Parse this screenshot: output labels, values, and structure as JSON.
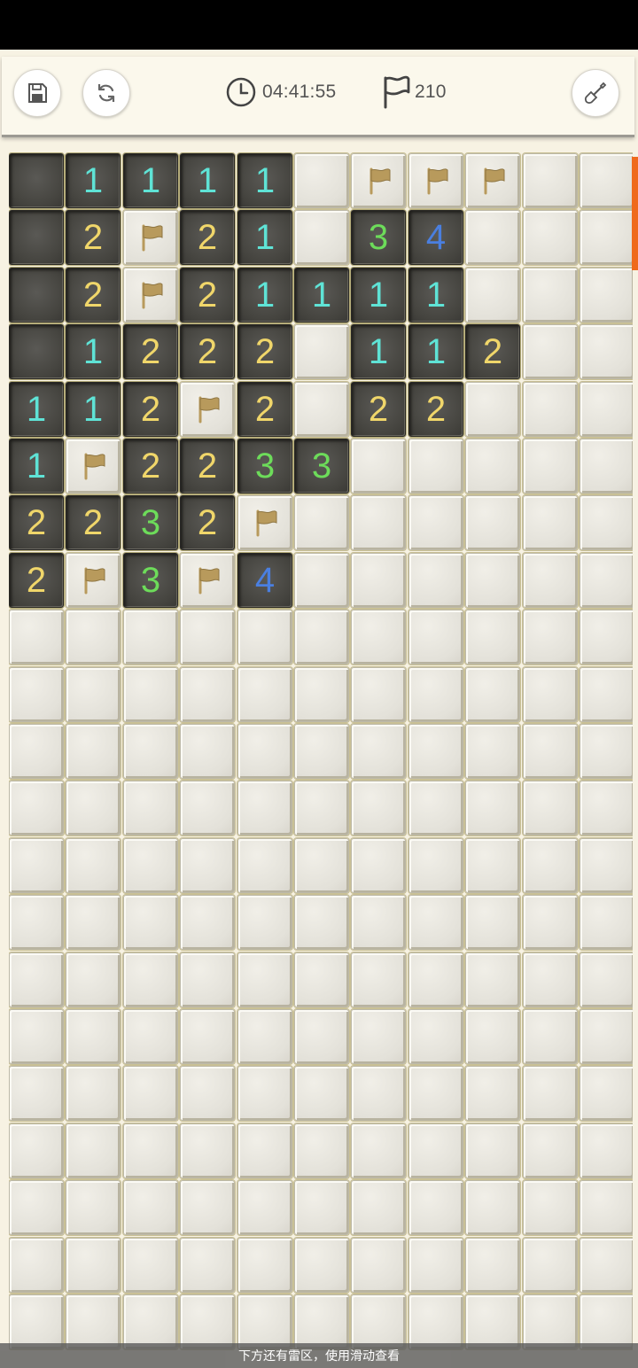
{
  "toolbar": {
    "timer": "04:41:55",
    "flag_count": "210",
    "save_icon": "save-icon",
    "restart_icon": "restart-icon",
    "clock_icon": "clock-icon",
    "flag_icon": "flag-icon",
    "shovel_icon": "shovel-icon"
  },
  "board": {
    "columns": 11,
    "visible_rows": 21,
    "rows": [
      [
        "E",
        "1",
        "1",
        "1",
        "1",
        "H",
        "F",
        "F",
        "F",
        "H",
        "H"
      ],
      [
        "E",
        "2",
        "F",
        "2",
        "1",
        "H",
        "3",
        "4",
        "H",
        "H",
        "H"
      ],
      [
        "E",
        "2",
        "F",
        "2",
        "1",
        "1",
        "1",
        "1",
        "H",
        "H",
        "H"
      ],
      [
        "E",
        "1",
        "2",
        "2",
        "2",
        "H",
        "1",
        "1",
        "2",
        "H",
        "H"
      ],
      [
        "1",
        "1",
        "2",
        "F",
        "2",
        "H",
        "2",
        "2",
        "H",
        "H",
        "H"
      ],
      [
        "1",
        "F",
        "2",
        "2",
        "3",
        "3",
        "H",
        "H",
        "H",
        "H",
        "H"
      ],
      [
        "2",
        "2",
        "3",
        "2",
        "F",
        "H",
        "H",
        "H",
        "H",
        "H",
        "H"
      ],
      [
        "2",
        "F",
        "3",
        "F",
        "4",
        "H",
        "H",
        "H",
        "H",
        "H",
        "H"
      ]
    ],
    "number_colors": {
      "1": "#5fe3d6",
      "2": "#f0d66a",
      "3": "#6ddc5a",
      "4": "#4a7fe0"
    },
    "flag_color": "#b89a5c"
  },
  "hint": "下方还有雷区，使用滑动查看",
  "colors": {
    "scroll_indicator": "#ef6a1c",
    "background": "#f7f2e3"
  }
}
